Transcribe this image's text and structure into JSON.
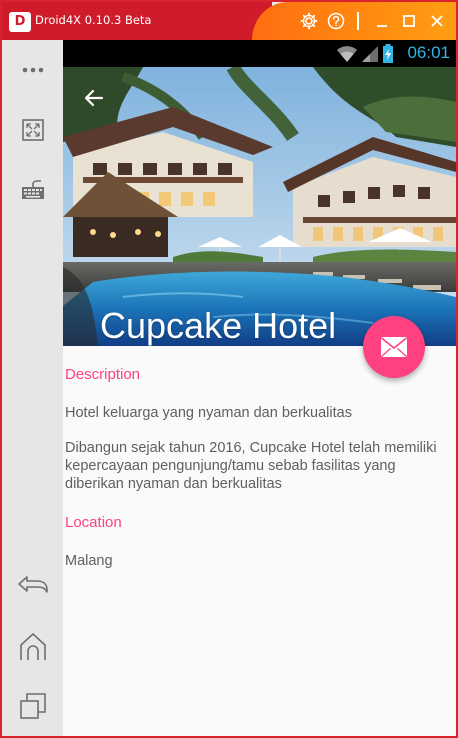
{
  "window": {
    "logo_text": "D",
    "title": "Droid4X 0.10.3 Beta",
    "buttons": [
      "gear-icon",
      "help-icon",
      "minimize-icon",
      "maximize-icon",
      "close-icon"
    ],
    "colors": {
      "title_left": "#cf1b2a",
      "title_right": "#ff8c10",
      "border": "#d9232e"
    }
  },
  "sidebar": {
    "items": [
      "more-icon",
      "fullscreen-icon",
      "keyboard-icon",
      "back-icon",
      "home-icon",
      "recent-apps-icon"
    ]
  },
  "statusbar": {
    "time": "06:01",
    "icons": [
      "wifi-icon",
      "signal-icon",
      "battery-charging-icon"
    ]
  },
  "hotel": {
    "name": "Cupcake Hotel",
    "description_heading": "Description",
    "description_short": "Hotel keluarga yang nyaman dan berkualitas",
    "description_long": "Dibangun sejak tahun 2016, Cupcake Hotel telah memiliki kepercayaan pengunjung/tamu sebab fasilitas yang diberikan nyaman dan berkualitas",
    "location_heading": "Location",
    "location": "Malang",
    "accent_color": "#ff4081",
    "fab_icon": "email-icon",
    "back_icon": "back-arrow-icon"
  }
}
